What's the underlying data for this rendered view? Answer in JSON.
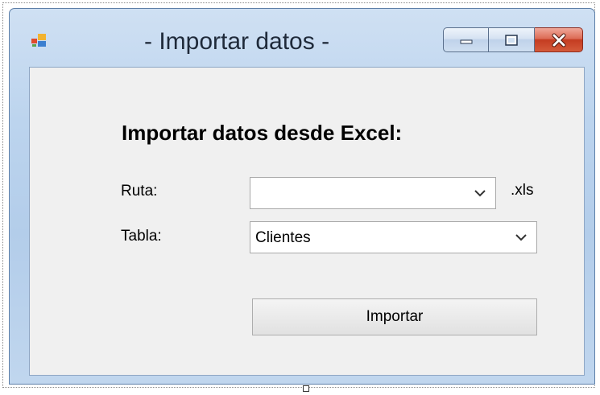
{
  "window": {
    "title": "- Importar datos -",
    "icon": "form-icon",
    "caption_buttons": [
      "minimize-icon",
      "maximize-icon",
      "close-icon"
    ]
  },
  "form": {
    "heading": "Importar datos desde Excel:",
    "ruta": {
      "label": "Ruta:",
      "value": "",
      "suffix": ".xls"
    },
    "tabla": {
      "label": "Tabla:",
      "value": "Clientes"
    },
    "import_button": "Importar"
  },
  "colors": {
    "frame": "#b3cdea",
    "client": "#f0f0f0",
    "close_button": "#c43c21"
  }
}
